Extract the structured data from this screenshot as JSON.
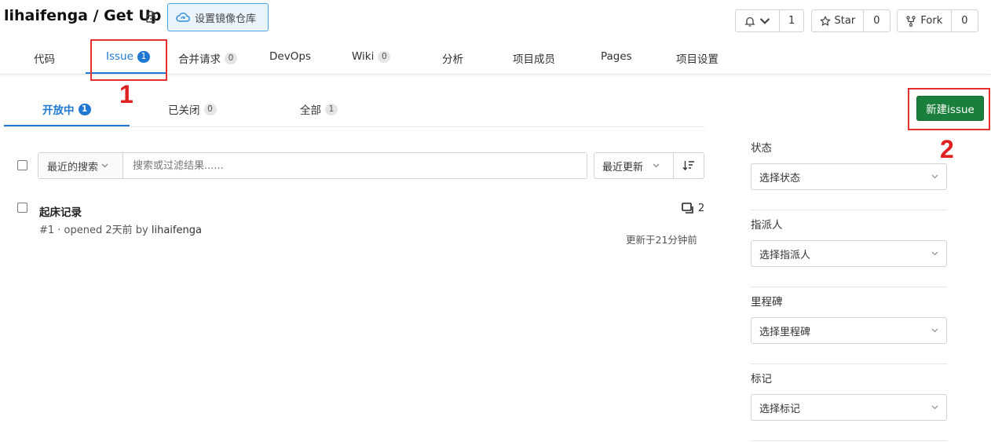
{
  "header": {
    "repo_title": "lihaifenga / Get Up",
    "mirror_button": "设置镜像仓库",
    "watch_count": "1",
    "star_label": "Star",
    "star_count": "0",
    "fork_label": "Fork",
    "fork_count": "0"
  },
  "nav": {
    "items": [
      {
        "label": "代码"
      },
      {
        "label": "Issue",
        "count": "1"
      },
      {
        "label": "合并请求",
        "count": "0"
      },
      {
        "label": "DevOps"
      },
      {
        "label": "Wiki",
        "count": "0"
      },
      {
        "label": "分析"
      },
      {
        "label": "项目成员"
      },
      {
        "label": "Pages"
      },
      {
        "label": "项目设置"
      }
    ]
  },
  "issue_tabs": {
    "items": [
      {
        "label": "开放中",
        "count": "1"
      },
      {
        "label": "已关闭",
        "count": "0"
      },
      {
        "label": "全部",
        "count": "1"
      }
    ],
    "new_issue_button": "新建issue"
  },
  "filter": {
    "recent_search_label": "最近的搜索",
    "search_placeholder": "搜索或过滤结果......",
    "sort_label": "最近更新"
  },
  "issues": [
    {
      "title": "起床记录",
      "ref": "#1 · opened 2天前 by ",
      "author": "lihaifenga",
      "comments": "2",
      "updated": "更新于21分钟前"
    }
  ],
  "sidebar": {
    "sections": [
      {
        "label": "状态",
        "placeholder": "选择状态"
      },
      {
        "label": "指派人",
        "placeholder": "选择指派人"
      },
      {
        "label": "里程碑",
        "placeholder": "选择里程碑"
      },
      {
        "label": "标记",
        "placeholder": "选择标记"
      }
    ]
  },
  "annotations": [
    "1",
    "2"
  ],
  "colors": {
    "accent": "#1f78d1",
    "primary_button": "#1a7f3c",
    "annotation": "#e53030"
  }
}
